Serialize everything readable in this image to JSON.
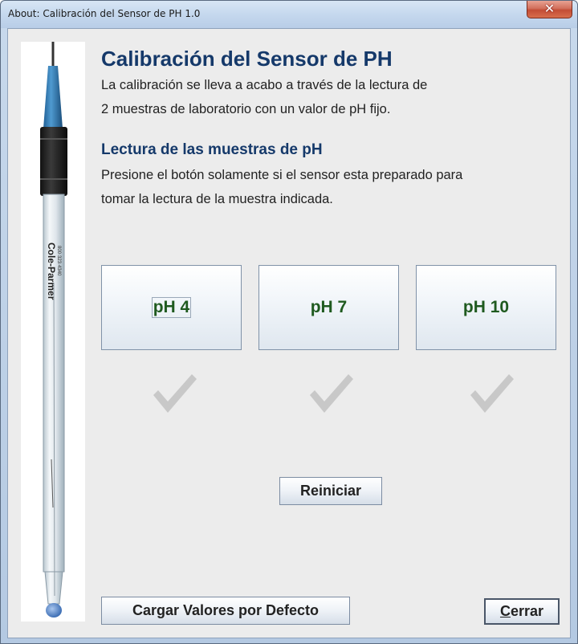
{
  "window": {
    "title": "About: Calibración del Sensor de PH 1.0",
    "close_glyph": "✕"
  },
  "probe": {
    "brand": "Cole-Parmer",
    "image_icon": "ph-probe-icon"
  },
  "main": {
    "heading": "Calibración del Sensor de PH",
    "description_line1": "La calibración se lleva a acabo a través de la lectura de",
    "description_line2": "2 muestras de laboratorio con un valor de pH fijo.",
    "subheading": "Lectura de las muestras de pH",
    "instruction_line1": "Presione el botón solamente si el sensor esta preparado para",
    "instruction_line2": "tomar la lectura de la muestra indicada."
  },
  "samples": [
    {
      "label": "pH 4",
      "completed": false
    },
    {
      "label": "pH 7",
      "completed": false
    },
    {
      "label": "pH 10",
      "completed": false
    }
  ],
  "buttons": {
    "reset": "Reiniciar",
    "load_defaults": "Cargar Valores por Defecto",
    "close_mnemonic": "C",
    "close_rest": "errar"
  },
  "colors": {
    "heading": "#15396a",
    "sample_label": "#1f5a1f",
    "check_inactive": "#c8c8c8"
  }
}
